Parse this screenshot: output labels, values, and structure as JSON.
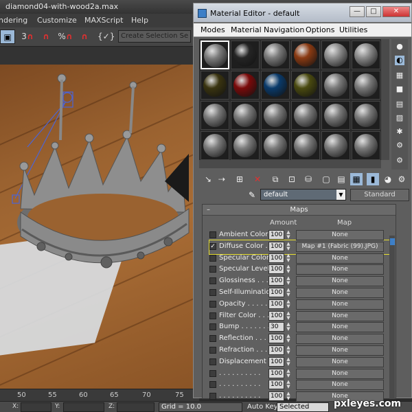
{
  "main_window": {
    "title": "diamond04-with-wood2a.max",
    "menu": [
      "ndering",
      "Customize",
      "MAXScript",
      "Help"
    ],
    "toolbar": {
      "snap_3": "3",
      "percent_snap": "%",
      "selection_set_placeholder": "Create Selection Se"
    }
  },
  "timeline": {
    "ticks": [
      "50",
      "55",
      "60",
      "65",
      "70",
      "75"
    ]
  },
  "statusbar": {
    "x_label": "X:",
    "y_label": "Y:",
    "z_label": "Z:",
    "grid": "Grid = 10.0",
    "autokey": "Auto Key",
    "selected": "Selected"
  },
  "material_editor": {
    "title": "Material Editor - default",
    "menu": [
      "Modes",
      "Material",
      "Navigation",
      "Options",
      "Utilities"
    ],
    "slots": [
      [
        "gray",
        "dark-sparkle",
        "gray",
        "copper",
        "gray-glossy",
        "gray-streak"
      ],
      [
        "gold",
        "red",
        "blue",
        "olive",
        "gray",
        "gray"
      ],
      [
        "gray",
        "gray",
        "gray",
        "gray",
        "gray",
        "gray"
      ],
      [
        "gray",
        "gray",
        "gray",
        "gray",
        "gray",
        "gray"
      ]
    ],
    "slot_colors": {
      "gray": "#7a7a7a",
      "gray-glossy": "#8c8c8c",
      "gray-streak": "#8a8a8a",
      "dark-sparkle": "#252525",
      "copper": "#8a3a12",
      "gold": "#3a3410",
      "red": "#7a0a0a",
      "blue": "#0a3a6a",
      "olive": "#4a4a10"
    },
    "material_name": "default",
    "material_type": "Standard",
    "maps": {
      "header": "Maps",
      "col_amount": "Amount",
      "col_map": "Map",
      "rows": [
        {
          "name": "Ambient Color . .",
          "amount": "100",
          "map": "None",
          "checked": false
        },
        {
          "name": "Diffuse Color . . .",
          "amount": "100",
          "map": "Map #1 (Fabric (99).JPG)",
          "checked": true
        },
        {
          "name": "Specular Color . .",
          "amount": "100",
          "map": "None",
          "checked": false
        },
        {
          "name": "Specular Level . .",
          "amount": "100",
          "map": "None",
          "checked": false
        },
        {
          "name": "Glossiness . . . .",
          "amount": "100",
          "map": "None",
          "checked": false
        },
        {
          "name": "Self-Illumination .",
          "amount": "100",
          "map": "None",
          "checked": false
        },
        {
          "name": "Opacity . . . . . .",
          "amount": "100",
          "map": "None",
          "checked": false
        },
        {
          "name": "Filter Color . . . .",
          "amount": "100",
          "map": "None",
          "checked": false
        },
        {
          "name": "Bump . . . . . . .",
          "amount": "30",
          "map": "None",
          "checked": false
        },
        {
          "name": "Reflection . . . .",
          "amount": "100",
          "map": "None",
          "checked": false
        },
        {
          "name": "Refraction . . . .",
          "amount": "100",
          "map": "None",
          "checked": false
        },
        {
          "name": "Displacement . . .",
          "amount": "100",
          "map": "None",
          "checked": false
        },
        {
          "name": ". . . . . . . . . .",
          "amount": "100",
          "map": "None",
          "checked": false
        },
        {
          "name": ". . . . . . . . . .",
          "amount": "100",
          "map": "None",
          "checked": false
        },
        {
          "name": ". . . . . . . . . .",
          "amount": "100",
          "map": "None",
          "checked": false
        }
      ]
    }
  },
  "watermark": "pxleyes.com"
}
